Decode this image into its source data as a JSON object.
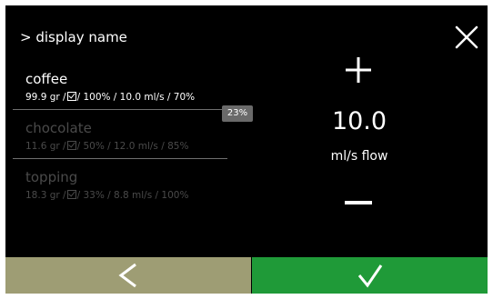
{
  "header": {
    "breadcrumb": "> display name"
  },
  "ingredients": [
    {
      "name": "coffee",
      "amount": "99.9 gr /",
      "details": "/ 100% / 10.0 ml/s / 70%",
      "active": true
    },
    {
      "name": "chocolate",
      "amount": "11.6 gr /",
      "details": "/ 50% / 12.0 ml/s / 85%",
      "active": false
    },
    {
      "name": "topping",
      "amount": "18.3 gr /",
      "details": "/ 33% / 8.8 ml/s / 100%",
      "active": false
    }
  ],
  "scroll_indicator": "23%",
  "adjuster": {
    "value": "10.0",
    "unit": "ml/s flow"
  },
  "icons": {
    "close": "close-icon",
    "plus": "plus-icon",
    "minus": "minus-icon",
    "back": "chevron-left-icon",
    "confirm": "checkmark-icon",
    "checkbox": "checkbox-checked-icon"
  },
  "colors": {
    "background": "#000000",
    "back_button": "#9e9d74",
    "confirm_button": "#1f9a38",
    "divider": "#6f6f6f",
    "inactive_text": "#4a4a4a",
    "badge": "#6a6a6a"
  }
}
